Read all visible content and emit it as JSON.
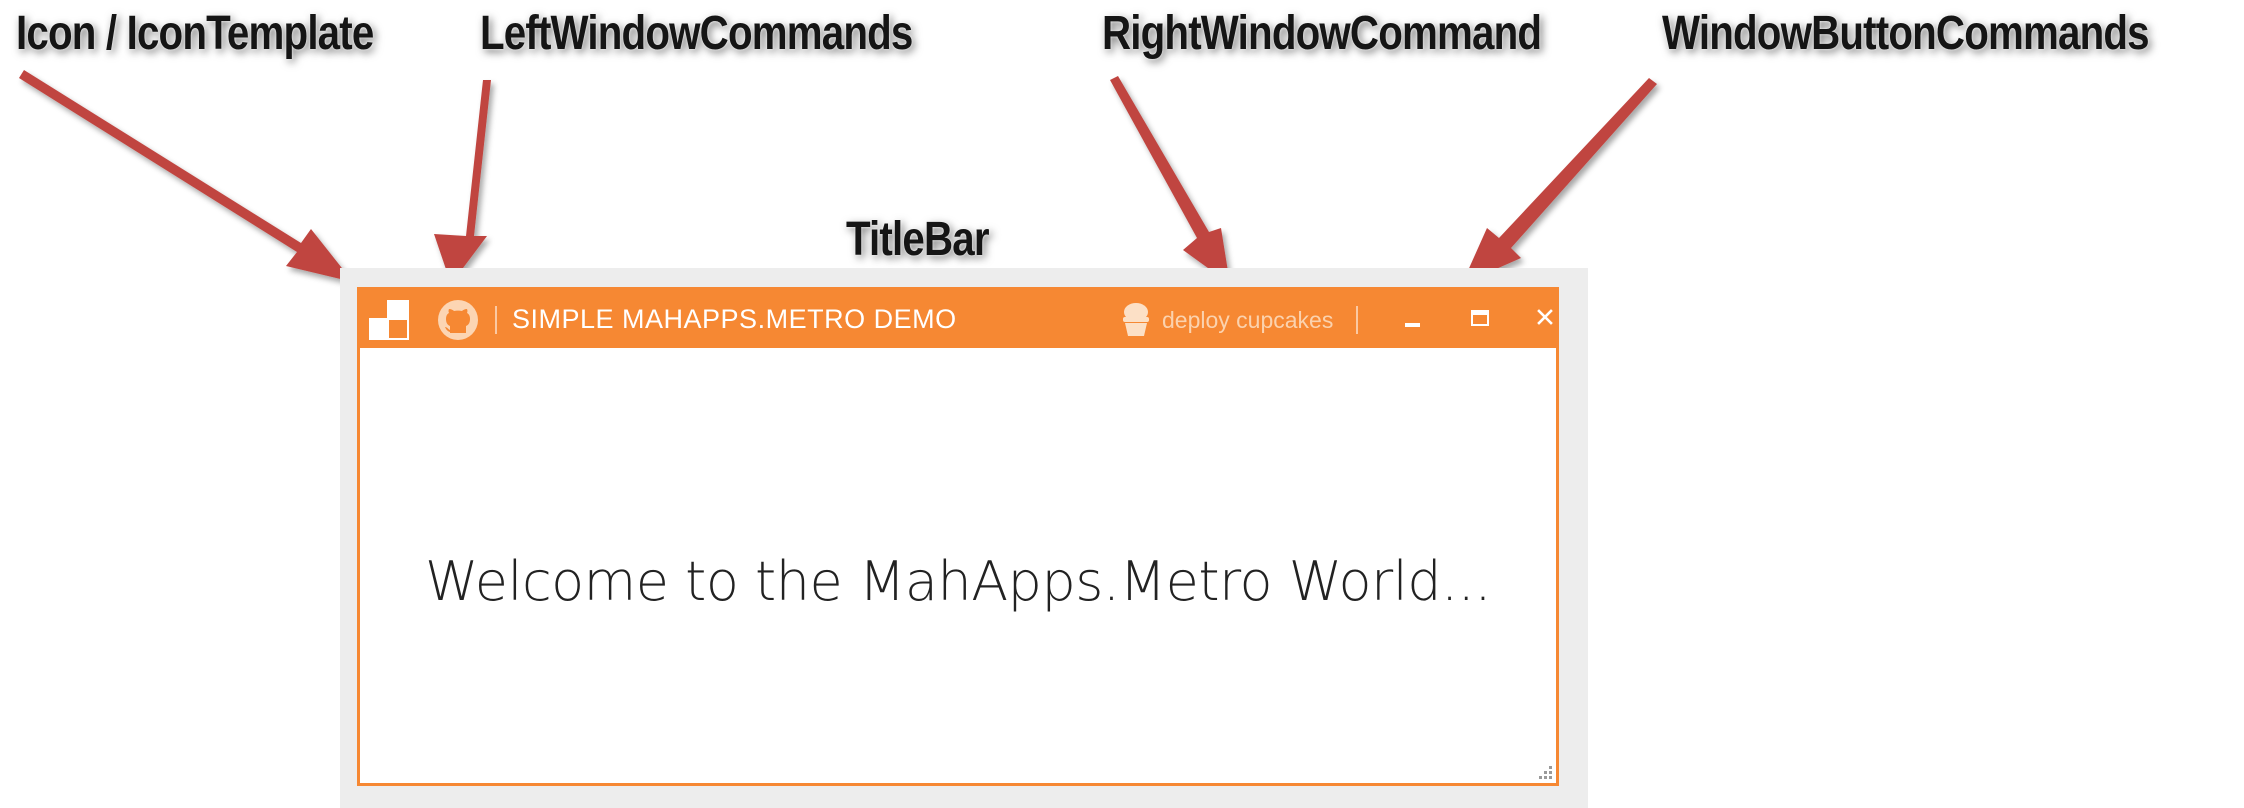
{
  "callouts": {
    "icon": "Icon / IconTemplate",
    "left_commands": "LeftWindowCommands",
    "right_command": "RightWindowCommand",
    "button_commands": "WindowButtonCommands",
    "titlebar": "TitleBar"
  },
  "window": {
    "title": "SIMPLE MAHAPPS.METRO DEMO",
    "left_command_icon": "github-icon",
    "right_command": {
      "label": "deploy cupcakes",
      "icon": "cupcake-icon"
    },
    "buttons": [
      "minimize-icon",
      "maximize-icon",
      "close-icon"
    ],
    "content": "Welcome to the MahApps.Metro World..."
  },
  "colors": {
    "accent": "#f68833",
    "arrow": "#c0443f",
    "right_command_text": "#fbd2ae"
  }
}
